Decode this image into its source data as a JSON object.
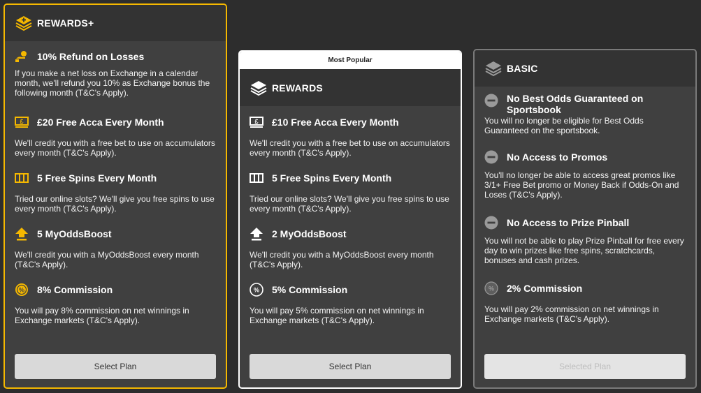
{
  "plans": [
    {
      "title": "REWARDS+",
      "button": "Select Plan",
      "features": [
        {
          "icon": "refund-icon",
          "title": "10% Refund on Losses",
          "desc": "If you make a net loss on Exchange in a calendar month, we'll refund you 10% as Exchange bonus the following month (T&C's Apply)."
        },
        {
          "icon": "cash-icon",
          "title": "£20 Free Acca Every Month",
          "desc": "We'll credit you with a free bet to use on accumulators every month (T&C's Apply)."
        },
        {
          "icon": "slot-reels-icon",
          "title": "5 Free Spins Every Month",
          "desc": "Tried our online slots? We'll give you free spins to use every month (T&C's Apply)."
        },
        {
          "icon": "boost-arrow-icon",
          "title": "5 MyOddsBoost",
          "desc": "We'll credit you with a MyOddsBoost every month (T&C's Apply)."
        },
        {
          "icon": "percent-icon",
          "title": "8% Commission",
          "desc": "You will pay 8% commission on net winnings in Exchange markets (T&C's Apply)."
        }
      ]
    },
    {
      "badge": "Most Popular",
      "title": "REWARDS",
      "button": "Select Plan",
      "features": [
        {
          "icon": "cash-icon",
          "title": "£10 Free Acca Every Month",
          "desc": "We'll credit you with a free bet to use on accumulators every month (T&C's Apply)."
        },
        {
          "icon": "slot-reels-icon",
          "title": "5 Free Spins Every Month",
          "desc": "Tried our online slots? We'll give you free spins to use every month (T&C's Apply)."
        },
        {
          "icon": "boost-arrow-icon",
          "title": "2 MyOddsBoost",
          "desc": "We'll credit you with a MyOddsBoost every month (T&C's Apply)."
        },
        {
          "icon": "percent-icon",
          "title": "5% Commission",
          "desc": "You will pay 5% commission on net winnings in Exchange markets (T&C's Apply)."
        }
      ]
    },
    {
      "title": "BASIC",
      "button": "Selected Plan",
      "features": [
        {
          "icon": "minus-circle-icon",
          "title": "No Best Odds Guaranteed on Sportsbook",
          "desc": "You will no longer be eligible for Best Odds Guaranteed on the sportsbook."
        },
        {
          "icon": "minus-circle-icon",
          "title": "No Access to Promos",
          "desc": "You'll no longer be able to access great promos like 3/1+ Free Bet promo or Money Back if Odds-On and Loses (T&C's Apply)."
        },
        {
          "icon": "minus-circle-icon",
          "title": "No Access to Prize Pinball",
          "desc": "You will not be able to play Prize Pinball for free every day to win prizes like free spins, scratchcards, bonuses and cash prizes."
        },
        {
          "icon": "percent-icon",
          "title": "2% Commission",
          "desc": "You will pay 2% commission on net winnings in Exchange markets (T&C's Apply)."
        }
      ]
    }
  ],
  "colors": {
    "gold": "#f5b800",
    "white": "#ffffff",
    "grey": "#9a9a9a"
  }
}
